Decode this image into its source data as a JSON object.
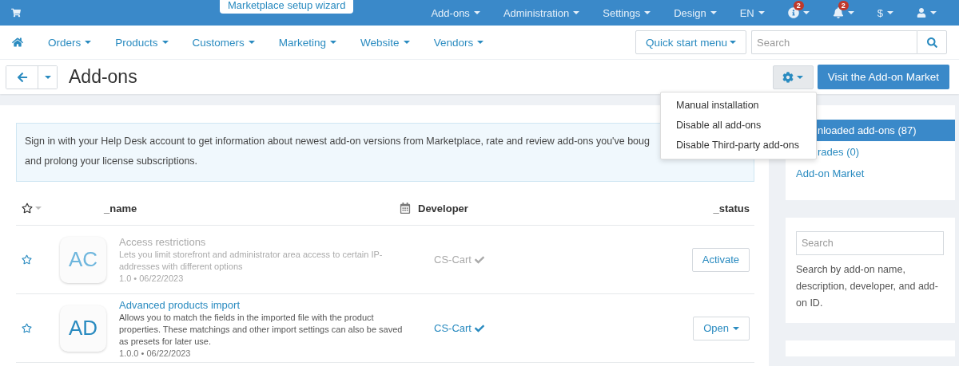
{
  "top_bar": {
    "wizard_button": "Marketplace setup wizard",
    "menus": [
      {
        "label": "Add-ons"
      },
      {
        "label": "Administration"
      },
      {
        "label": "Settings"
      },
      {
        "label": "Design"
      },
      {
        "label": "EN"
      }
    ],
    "icons": [
      {
        "kind": "help",
        "badge": "2"
      },
      {
        "kind": "bell",
        "badge": "2"
      },
      {
        "kind": "currency",
        "label": "$"
      },
      {
        "kind": "user"
      }
    ]
  },
  "nav": {
    "items": [
      "Orders",
      "Products",
      "Customers",
      "Marketing",
      "Website",
      "Vendors"
    ],
    "quick_start": "Quick start menu",
    "search": {
      "placeholder": "Search"
    }
  },
  "title_bar": {
    "title": "Add-ons",
    "market_button": "Visit the Add-on Market"
  },
  "settings_menu": [
    "Manual installation",
    "Disable all add-ons",
    "Disable Third-party add-ons"
  ],
  "info": {
    "lines": [
      "Sign in with your Help Desk account to get information about newest add-on versions from Marketplace, rate and review add-ons you've boug",
      "and prolong your license subscriptions."
    ]
  },
  "table": {
    "columns": [
      "_name",
      "Developer",
      "_status"
    ],
    "rows": [
      {
        "initials": "AC",
        "name": "Access restrictions",
        "description": "Lets you limit storefront and administrator area access to certain IP-addresses with different options",
        "meta": "1.0 • 06/22/2023",
        "developer": "CS-Cart",
        "active": false,
        "action": "Activate",
        "action_menu": false
      },
      {
        "initials": "AD",
        "name": "Advanced products import",
        "description": "Allows you to match the fields in the imported file with the product properties. These matchings and other import settings can also be saved as presets for later use.",
        "meta": "1.0.0 • 06/22/2023",
        "developer": "CS-Cart",
        "active": true,
        "action": "Open",
        "action_menu": true
      }
    ]
  },
  "sidebar": {
    "items": [
      {
        "label": "nloaded add-ons (87)",
        "selected": true,
        "covered": true
      },
      {
        "label": "rades (0)",
        "selected": false,
        "covered": true
      },
      {
        "label": "Add-on Market",
        "selected": false,
        "covered": false
      }
    ],
    "search": {
      "placeholder": "Search",
      "hint": "Search by add-on name, description, developer, and add-on ID."
    }
  }
}
